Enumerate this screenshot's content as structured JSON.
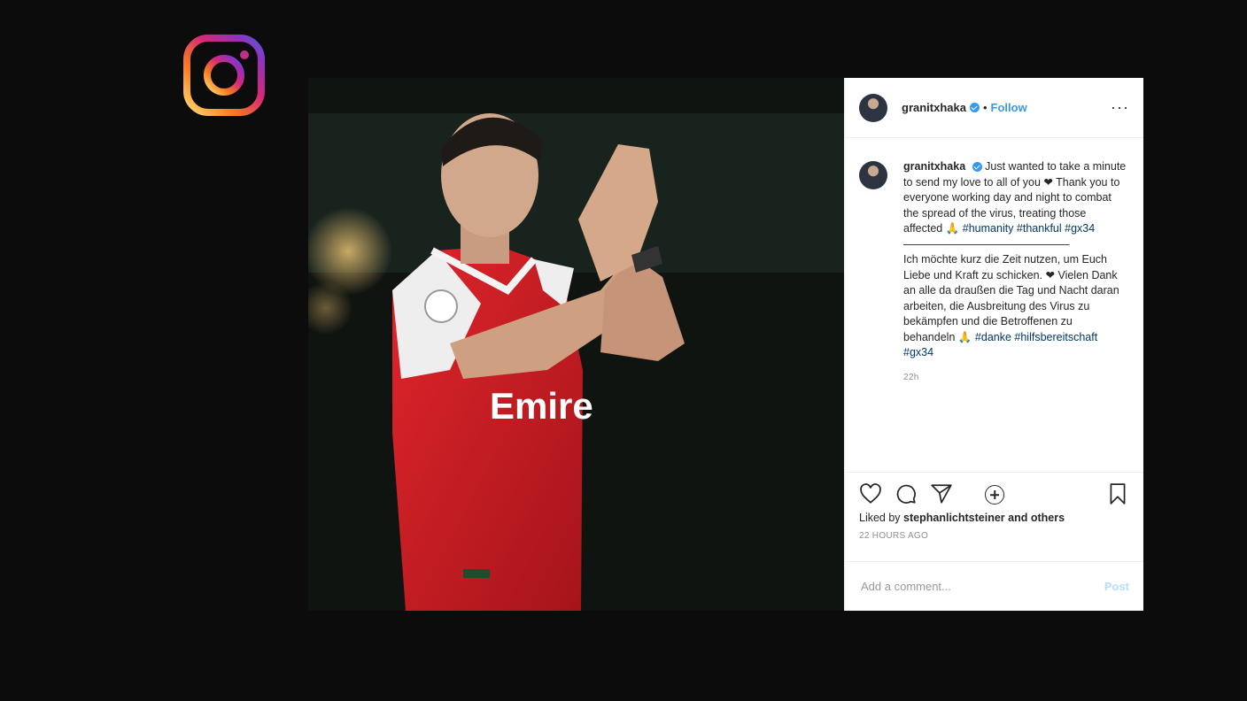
{
  "post": {
    "username": "granitxhaka",
    "follow_label": "Follow",
    "more_label": "···",
    "dot": "•",
    "caption_en": "Just wanted to take a minute to send my love to all of you ❤ Thank you to everyone working day and night to combat the spread of the virus, treating those affected 🙏",
    "tags_en": "#humanity #thankful #gx34",
    "divider": "———————————————",
    "caption_de": "Ich möchte kurz die Zeit nutzen, um Euch Liebe und Kraft zu schicken. ❤ Vielen Dank an alle da draußen die Tag und Nacht daran arbeiten, die Ausbreitung des Virus zu bekämpfen und die Betroffenen zu behandeln 🙏",
    "tags_de": "#danke #hilfsbereitschaft #gx34",
    "comment_time": "22h",
    "liked_by_prefix": "Liked by",
    "liked_by_user": "stephanlichtsteiner",
    "liked_by_suffix": "and others",
    "date": "22 HOURS AGO",
    "add_comment_placeholder": "Add a comment...",
    "post_label": "Post"
  },
  "photo": {
    "jersey_text": "Emire"
  },
  "icons": [
    "instagram-logo",
    "verified-badge-icon",
    "more-icon",
    "load-more-icon",
    "heart-icon",
    "comment-icon",
    "share-icon",
    "bookmark-icon"
  ],
  "colors": {
    "accent": "#3897f0",
    "jersey": "#d11f26",
    "background": "#0c0c0c"
  }
}
